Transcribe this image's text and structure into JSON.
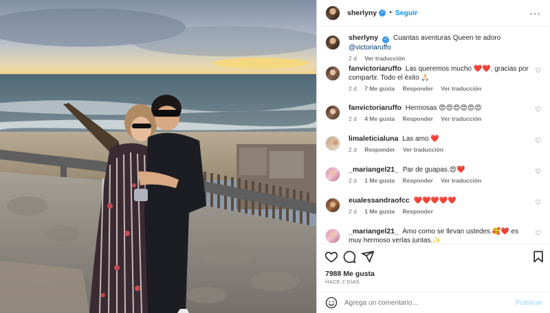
{
  "photo": {
    "alt": ""
  },
  "header": {
    "username": "sherlyny",
    "dot": "•",
    "follow_label": "Seguir",
    "more_label": "···"
  },
  "caption": {
    "username": "sherlyny",
    "text": "Cuantas aventuras Queen te adoro",
    "mention": "@victoriaruffo",
    "time": "2 d",
    "translate": "Ver traducción"
  },
  "comments": [
    {
      "username": "fanvictoriaruffo",
      "text": "Las queremos mucho ❤️❤️, gracias por compartir. Todo el éxito 🙏🏻",
      "time": "2 d",
      "likes": "7 Me gusta",
      "reply": "Responder",
      "translate": "Ver traducción"
    },
    {
      "username": "fanvictoriaruffo",
      "text": "Hermosas 😍😍😍😍😍😍",
      "time": "2 d",
      "likes": "4 Me gusta",
      "reply": "Responder",
      "translate": "Ver traducción"
    },
    {
      "username": "limaleticialuna",
      "text": "Las amo ❤️",
      "time": "2 d",
      "reply": "Responder",
      "translate": "Ver traducción"
    },
    {
      "username": "_mariangel21_",
      "text": "Par de guapas.😍❤️",
      "time": "2 d",
      "likes": "1 Me gusta",
      "reply": "Responder",
      "translate": "Ver traducción"
    },
    {
      "username": "eualessandraofcc",
      "text": "❤️❤️❤️❤️❤️",
      "time": "2 d",
      "likes": "1 Me gusta",
      "reply": "Responder"
    },
    {
      "username": "_mariangel21_",
      "text": "Amo como se llevan ustedes.🥰❤️ es muy hermoso verlas juntas.✨"
    }
  ],
  "actions": {
    "like_count": "7988 Me gusta",
    "posted": "HACE 2 DÍAS"
  },
  "composer": {
    "placeholder": "Agrega un comentario...",
    "publish_label": "Publicar"
  },
  "colors": {
    "link": "#0095f6",
    "verified": "#3897f0",
    "meta": "#737373"
  },
  "icons": [
    "heart-icon",
    "comment-icon",
    "share-icon",
    "bookmark-icon",
    "emoji-icon",
    "more-options-icon",
    "verified-badge-icon"
  ]
}
